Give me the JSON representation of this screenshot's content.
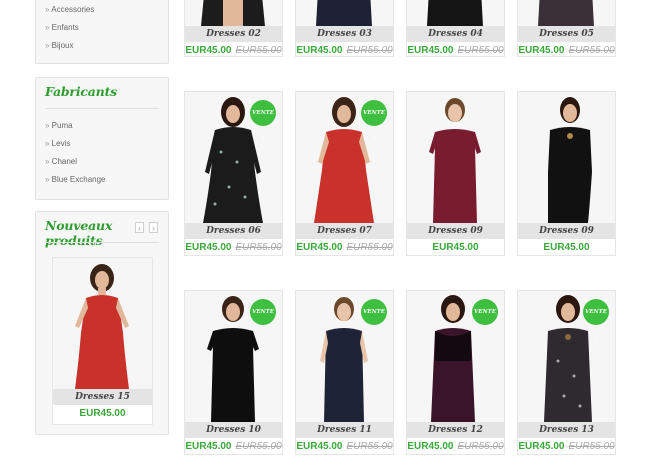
{
  "categories_top": [
    "Accessories",
    "Enfants",
    "Bijoux"
  ],
  "manufacturers": {
    "title": "Fabricants",
    "items": [
      "Puma",
      "Levis",
      "Chanel",
      "Blue Exchange"
    ]
  },
  "new_products": {
    "title": "Nouveaux produits",
    "prev_icon": "‹",
    "next_icon": "›",
    "product": {
      "name": "Dresses 15",
      "price": "EUR45.00"
    }
  },
  "badge_text": "VENTE !",
  "products_row1": [
    {
      "name": "Dresses 02",
      "price": "EUR45.00",
      "old_price": "EUR55.00"
    },
    {
      "name": "Dresses 03",
      "price": "EUR45.00",
      "old_price": "EUR55.00"
    },
    {
      "name": "Dresses 04",
      "price": "EUR45.00",
      "old_price": "EUR55.00"
    },
    {
      "name": "Dresses 05",
      "price": "EUR45.00",
      "old_price": "EUR55.00"
    }
  ],
  "products_row2": [
    {
      "name": "Dresses 06",
      "price": "EUR45.00",
      "old_price": "EUR55.00"
    },
    {
      "name": "Dresses 07",
      "price": "EUR45.00",
      "old_price": "EUR55.00"
    },
    {
      "name": "Dresses 09",
      "price": "EUR45.00"
    },
    {
      "name": "Dresses 09",
      "price": "EUR45.00"
    }
  ],
  "products_row3": [
    {
      "name": "Dresses 10",
      "price": "EUR45.00",
      "old_price": "EUR55.00"
    },
    {
      "name": "Dresses 11",
      "price": "EUR45.00",
      "old_price": "EUR55.00"
    },
    {
      "name": "Dresses 12",
      "price": "EUR45.00",
      "old_price": "EUR55.00"
    },
    {
      "name": "Dresses 13",
      "price": "EUR45.00",
      "old_price": "EUR55.00"
    }
  ],
  "colors": {
    "accent": "#3aa83a",
    "badge": "#3fbf3f"
  }
}
